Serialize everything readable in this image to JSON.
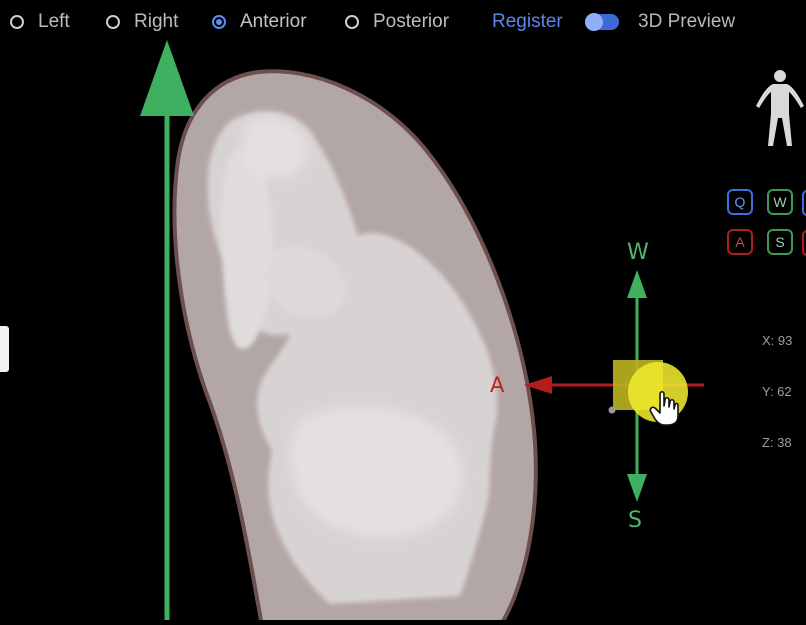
{
  "top_bar": {
    "options": [
      {
        "label": "Left",
        "selected": false
      },
      {
        "label": "Right",
        "selected": false
      },
      {
        "label": "Anterior",
        "selected": true
      },
      {
        "label": "Posterior",
        "selected": false
      }
    ],
    "register_label": "Register",
    "register_toggle_on": true,
    "preview_label": "3D Preview"
  },
  "viewport": {
    "axis_labels": {
      "up": "W",
      "down": "S",
      "left": "A"
    }
  },
  "keypad": {
    "row1": [
      "Q",
      "W"
    ],
    "row2": [
      "A",
      "S"
    ]
  },
  "coords": {
    "x": "X: 93",
    "y": "Y: 62",
    "z": "Z: 38"
  },
  "colors": {
    "accent_blue": "#5b8ff0",
    "axis_green": "#3fb05f",
    "axis_red": "#b31c1c",
    "gizmo_yellow": "#e6e22a",
    "organ_outer": "#b3a6a6",
    "organ_inner": "#dedada"
  }
}
